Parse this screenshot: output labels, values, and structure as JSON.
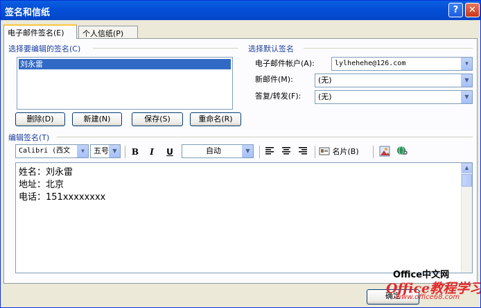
{
  "window": {
    "title": "签名和信纸",
    "help": "?",
    "close": "✕"
  },
  "tabs": [
    {
      "label": "电子邮件签名(E)"
    },
    {
      "label": "个人信纸(P)"
    }
  ],
  "select_sig": {
    "heading": "选择要编辑的签名(C)",
    "items": [
      "刘永雷"
    ],
    "buttons": {
      "delete": "删除(D)",
      "new": "新建(N)",
      "save": "保存(S)",
      "rename": "重命名(R)"
    }
  },
  "defaults": {
    "heading": "选择默认签名",
    "account_label": "电子邮件帐户(A):",
    "account_value": "lylhehehe@126.com",
    "new_label": "新邮件(M):",
    "new_value": "(无)",
    "reply_label": "答复/转发(F):",
    "reply_value": "(无)"
  },
  "edit": {
    "heading": "编辑签名(T)",
    "toolbar": {
      "font": "Calibri (西文",
      "size": "五号",
      "bold": "B",
      "italic": "I",
      "underline": "U",
      "color": "自动",
      "card": "名片(B)"
    },
    "lines": [
      "姓名：刘永雷",
      "地址：北京",
      "电话：151xxxxxxxx"
    ]
  },
  "dialog_buttons": {
    "ok": "确定"
  },
  "watermark": {
    "line1": "Office中文网",
    "line2": "Office教程学习网",
    "line3": "www.office68.com"
  }
}
